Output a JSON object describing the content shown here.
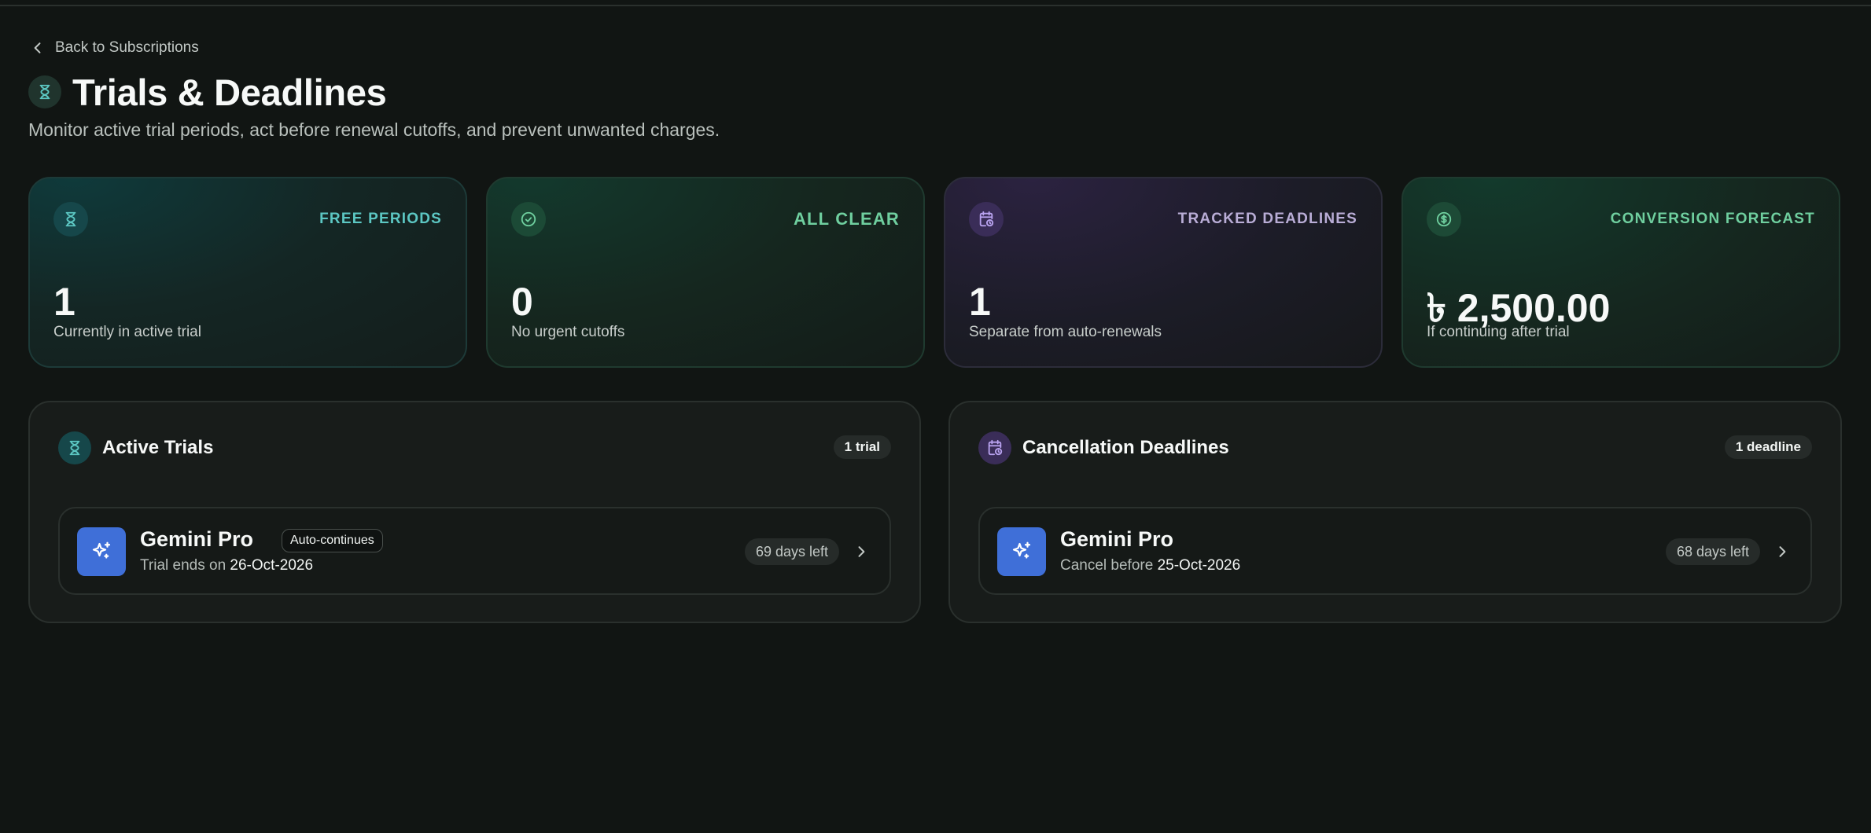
{
  "nav": {
    "back_label": "Back to Subscriptions"
  },
  "header": {
    "title": "Trials & Deadlines",
    "subtitle": "Monitor active trial periods, act before renewal cutoffs, and prevent unwanted charges."
  },
  "stats": [
    {
      "label": "FREE PERIODS",
      "value": "1",
      "desc": "Currently in active trial",
      "icon": "hourglass-icon",
      "accent": "#5cc7c3"
    },
    {
      "label": "ALL CLEAR",
      "value": "0",
      "desc": "No urgent cutoffs",
      "icon": "check-circle-icon",
      "accent": "#6fcf9f"
    },
    {
      "label": "TRACKED DEADLINES",
      "value": "1",
      "desc": "Separate from auto-renewals",
      "icon": "calendar-clock-icon",
      "accent": "#b9add6"
    },
    {
      "label": "CONVERSION FORECAST",
      "value": "৳ 2,500.00",
      "desc": "If continuing after trial",
      "icon": "dollar-circle-icon",
      "accent": "#6fcf9f"
    }
  ],
  "active_trials": {
    "title": "Active Trials",
    "count": "1 trial",
    "items": [
      {
        "name": "Gemini Pro",
        "badge": "Auto-continues",
        "sub_prefix": "Trial ends on",
        "date": "26-Oct-2026",
        "days": "69 days left",
        "icon": "sparkles-icon"
      }
    ]
  },
  "cancellation_deadlines": {
    "title": "Cancellation Deadlines",
    "count": "1 deadline",
    "items": [
      {
        "name": "Gemini Pro",
        "sub_prefix": "Cancel before",
        "date": "25-Oct-2026",
        "days": "68 days left",
        "icon": "sparkles-icon"
      }
    ]
  },
  "colors": {
    "background": "#111513",
    "app_icon": "#3f6fd8",
    "teal": "#5cc7c3",
    "green": "#6fcf9f",
    "purple": "#b9add6"
  }
}
